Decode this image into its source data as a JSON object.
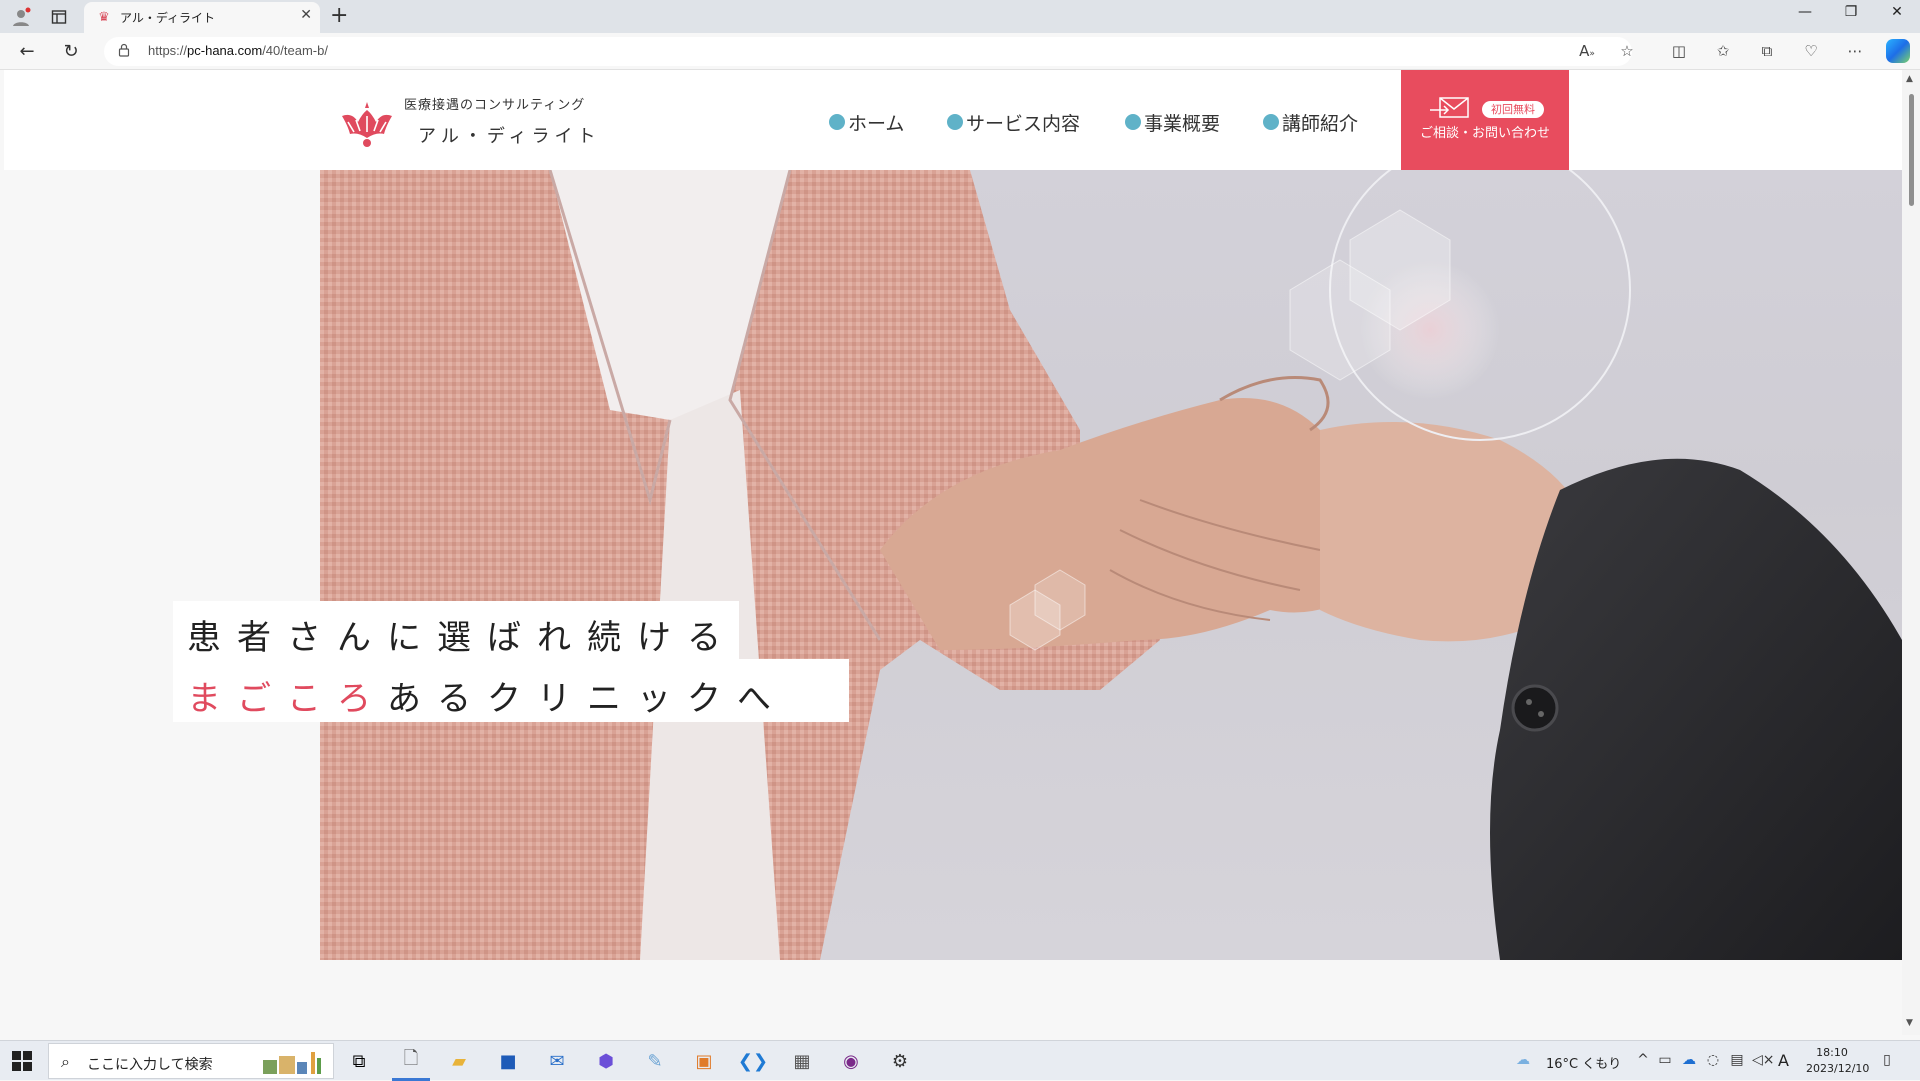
{
  "browser": {
    "tab_title": "アル・ディライト",
    "tab_close": "✕",
    "new_tab": "+",
    "url_prefix": "https://",
    "url_host": "pc-hana.com",
    "url_path": "/40/team-b/",
    "window_controls": [
      "—",
      "❐",
      "✕"
    ]
  },
  "site": {
    "logo_sub": "医療接遇のコンサルティング",
    "logo_name": "アル・ディライト",
    "nav": [
      "ホーム",
      "サービス内容",
      "事業概要",
      "講師紹介"
    ],
    "contact_badge": "初回無料",
    "contact_label": "ご相談・お問い合わせ",
    "tagline_line1": "患者さんに選ばれ続ける",
    "tagline_accent": "まごころ",
    "tagline_rest": "あるクリニックへ"
  },
  "taskbar": {
    "search_placeholder": "ここに入力して検索",
    "weather": "16°C くもり",
    "time": "18:10",
    "date": "2023/12/10",
    "ime": "A"
  },
  "colors": {
    "accent": "#e84c5e",
    "nav_dot": "#5fb2c8",
    "tagline_accent": "#e04a5e"
  }
}
